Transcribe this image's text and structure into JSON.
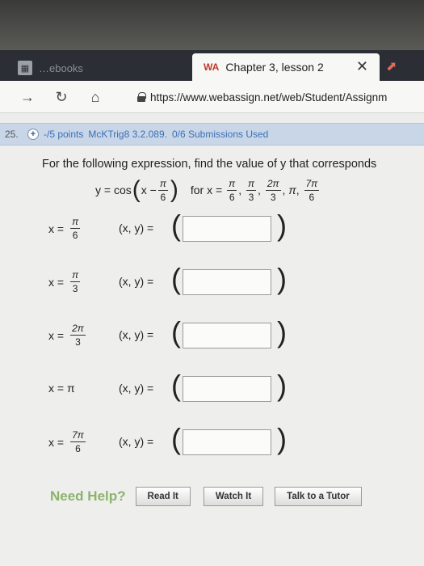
{
  "browser": {
    "inactive_tab_title": "…ebooks",
    "active_tab_title": "Chapter 3, lesson 2",
    "active_tab_favicon": "WA",
    "close_glyph": "✕",
    "url": "https://www.webassign.net/web/Student/Assignm"
  },
  "question": {
    "number": "25.",
    "points": "-/5 points",
    "reference": "McKTrig8 3.2.089.",
    "submissions": "0/6 Submissions Used",
    "prompt": "For the following expression, find the value of y that corresponds",
    "formula": {
      "lhs": "y = cos",
      "inner_x": "x −",
      "inner_num": "π",
      "inner_den": "6",
      "for_label": "for x =",
      "values": [
        {
          "num": "π",
          "den": "6"
        },
        {
          "num": "π",
          "den": "3"
        },
        {
          "num": "2π",
          "den": "3"
        },
        {
          "plain": "π"
        },
        {
          "num": "7π",
          "den": "6"
        }
      ]
    },
    "rows": [
      {
        "x_prefix": "x =",
        "num": "π",
        "den": "6",
        "pair_label": "(x, y) =",
        "value": ""
      },
      {
        "x_prefix": "x =",
        "num": "π",
        "den": "3",
        "pair_label": "(x, y) =",
        "value": ""
      },
      {
        "x_prefix": "x =",
        "num": "2π",
        "den": "3",
        "pair_label": "(x, y) =",
        "value": ""
      },
      {
        "x_prefix": "x = π",
        "pair_label": "(x, y) =",
        "value": ""
      },
      {
        "x_prefix": "x =",
        "num": "7π",
        "den": "6",
        "pair_label": "(x, y) =",
        "value": ""
      }
    ],
    "help": {
      "label": "Need Help?",
      "buttons": [
        "Read It",
        "Watch It",
        "Talk to a Tutor"
      ]
    }
  }
}
